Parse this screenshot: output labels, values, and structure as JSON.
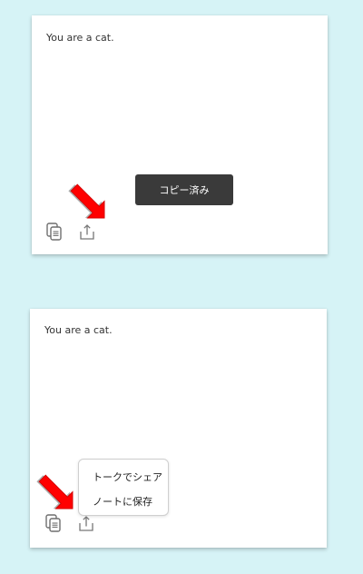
{
  "panel_1": {
    "message": "You are a cat.",
    "toast": "コピー済み",
    "copy_icon": "copy-icon",
    "share_icon": "share-icon"
  },
  "panel_2": {
    "message": "You are a cat.",
    "menu": {
      "items": [
        {
          "label": "トークでシェア"
        },
        {
          "label": "ノートに保存"
        }
      ]
    },
    "copy_icon": "copy-icon",
    "share_icon": "share-icon"
  },
  "colors": {
    "background": "#d6f3f6",
    "panel": "#ffffff",
    "toast": "#3a3a3a",
    "arrow": "#ff0000"
  }
}
